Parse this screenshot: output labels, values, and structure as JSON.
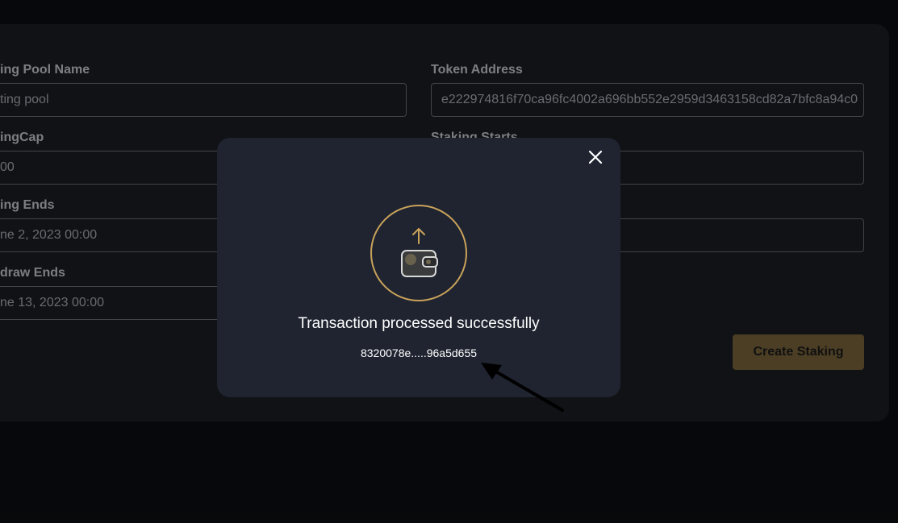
{
  "form": {
    "pool_name_label": "ing Pool Name",
    "pool_name_value": "ting pool",
    "token_address_label": "Token Address",
    "token_address_value": "e222974816f70ca96fc4002a696bb552e2959d3463158cd82a7bfc8a94c0",
    "staking_cap_label": "ingCap",
    "staking_cap_value": "00",
    "staking_starts_label": "Staking Starts",
    "staking_ends_label": "ing Ends",
    "staking_ends_value": "ne 2, 2023 00:00",
    "withdraw_ends_label": "draw Ends",
    "withdraw_ends_value": "ne 13, 2023 00:00",
    "create_button_label": "Create Staking"
  },
  "modal": {
    "message": "Transaction processed successfully",
    "tx_hash": "8320078e.....96a5d655"
  },
  "colors": {
    "accent": "#c9a25a",
    "button": "#7a653a",
    "modal_bg": "#1f2430",
    "panel_bg": "#1a1d23",
    "page_bg": "#0c0e12"
  },
  "icons": {
    "close": "close-icon",
    "wallet": "wallet-icon",
    "upload_arrow": "arrow-up-icon",
    "annotation_arrow": "annotation-arrow"
  }
}
